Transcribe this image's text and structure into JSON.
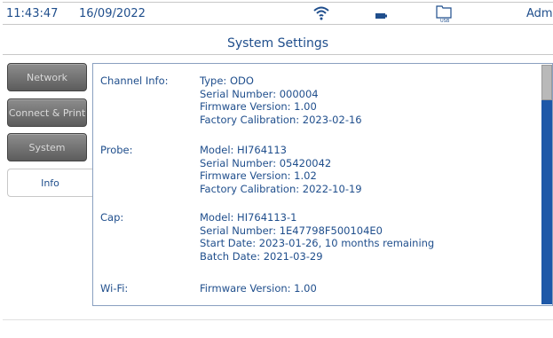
{
  "status_bar": {
    "time": "11:43:47",
    "date": "16/09/2022",
    "user": "Admi",
    "icons": [
      "wifi-icon",
      "battery-icon",
      "folder-icon"
    ]
  },
  "title": "System Settings",
  "tabs": [
    {
      "label": "Network",
      "active": false
    },
    {
      "label": "Connect & Print",
      "active": false
    },
    {
      "label": "System",
      "active": false
    },
    {
      "label": "Info",
      "active": true
    }
  ],
  "info": {
    "channel": {
      "label": "Channel Info:",
      "lines": [
        "Type: ODO",
        "Serial Number: 000004",
        "Firmware Version: 1.00",
        "Factory Calibration: 2023-02-16"
      ]
    },
    "probe": {
      "label": "Probe:",
      "lines": [
        "Model: HI764113",
        "Serial Number: 05420042",
        "Firmware Version: 1.02",
        "Factory Calibration: 2022-10-19"
      ]
    },
    "cap": {
      "label": "Cap:",
      "lines": [
        "Model: HI764113-1",
        "Serial Number: 1E47798F500104E0",
        "Start Date: 2023-01-26, 10 months remaining",
        "Batch Date: 2021-03-29"
      ]
    },
    "wifi": {
      "label": "Wi-Fi:",
      "lines": [
        "Firmware Version: 1.00"
      ]
    }
  },
  "colors": {
    "text": "#1f4e8c",
    "scrollbar": "#1e58a8",
    "tab_inactive": "#6e6e6e"
  }
}
